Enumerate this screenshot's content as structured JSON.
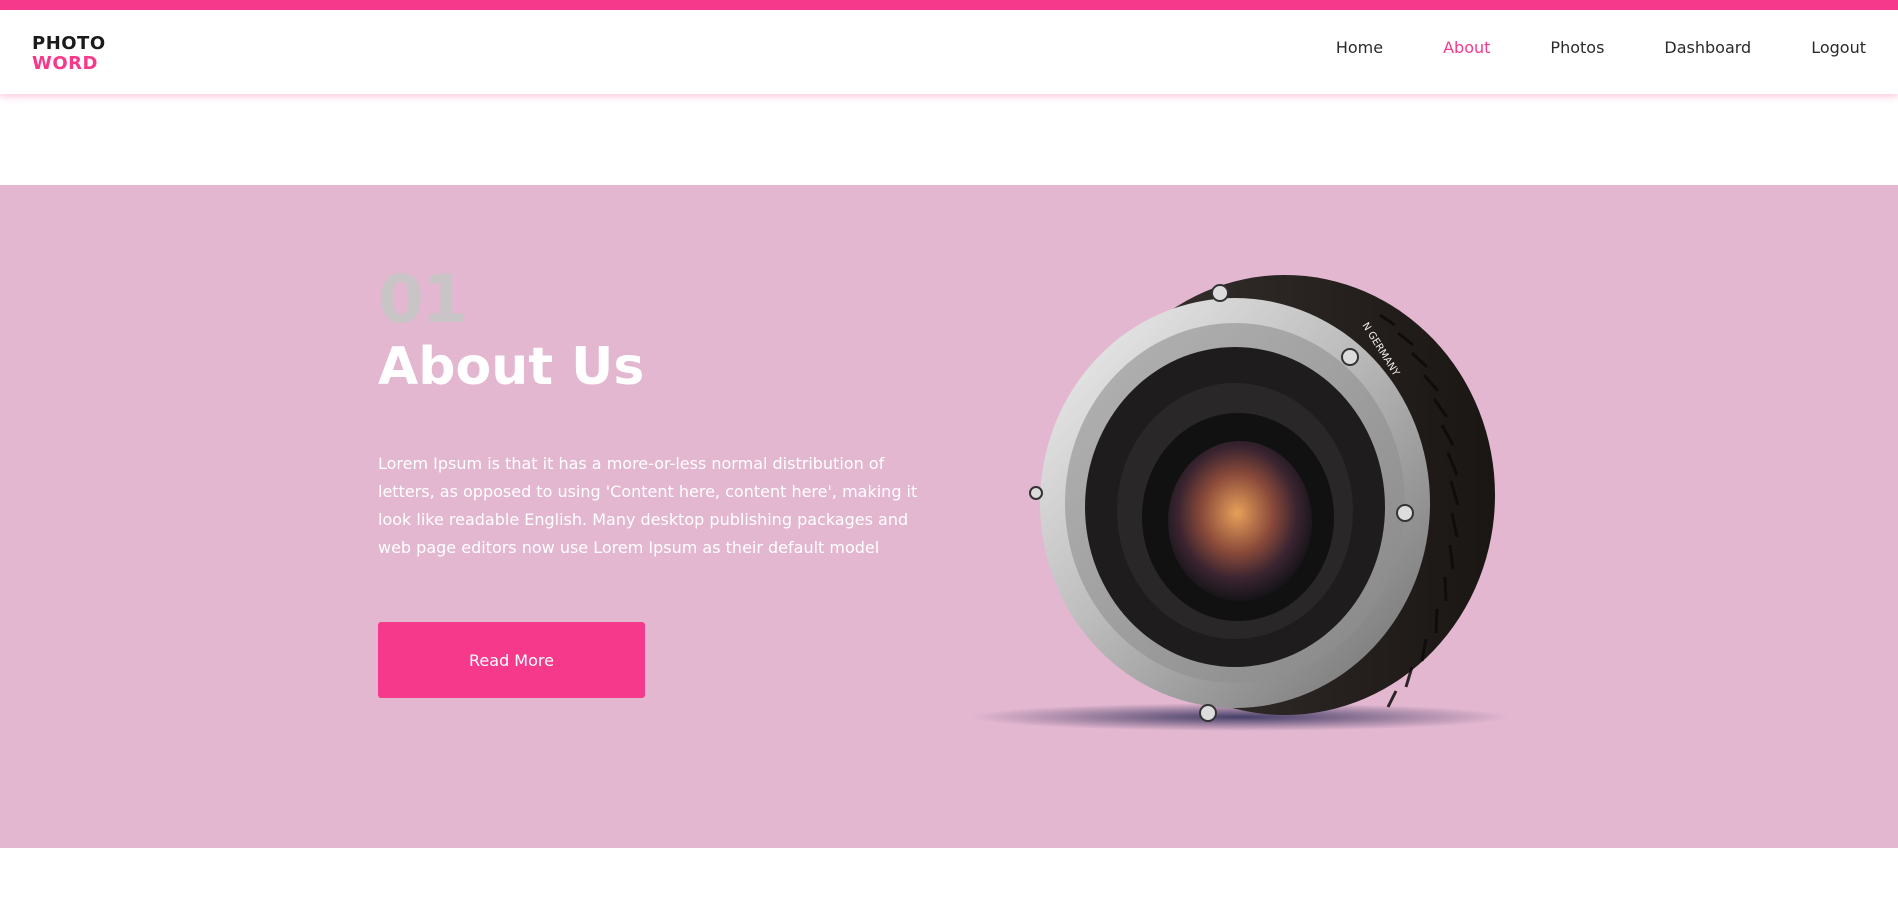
{
  "header": {
    "logo_line1": "PHOTO",
    "logo_line2": "WORD",
    "nav": [
      "Home",
      "About",
      "Photos",
      "Dashboard",
      "Logout"
    ],
    "active_nav": "About"
  },
  "about": {
    "number": "01",
    "title": "About Us",
    "description": "Lorem Ipsum is that it has a more-or-less normal distribution of letters, as opposed to using 'Content here, content here', making it look like readable English. Many desktop publishing packages and web page editors now use Lorem Ipsum as their default model",
    "button_label": "Read More",
    "lens_text": "N GERMANY"
  },
  "colors": {
    "accent": "#f7398c",
    "section_bg": "#e3b7d0",
    "number": "#c9c5c6"
  }
}
